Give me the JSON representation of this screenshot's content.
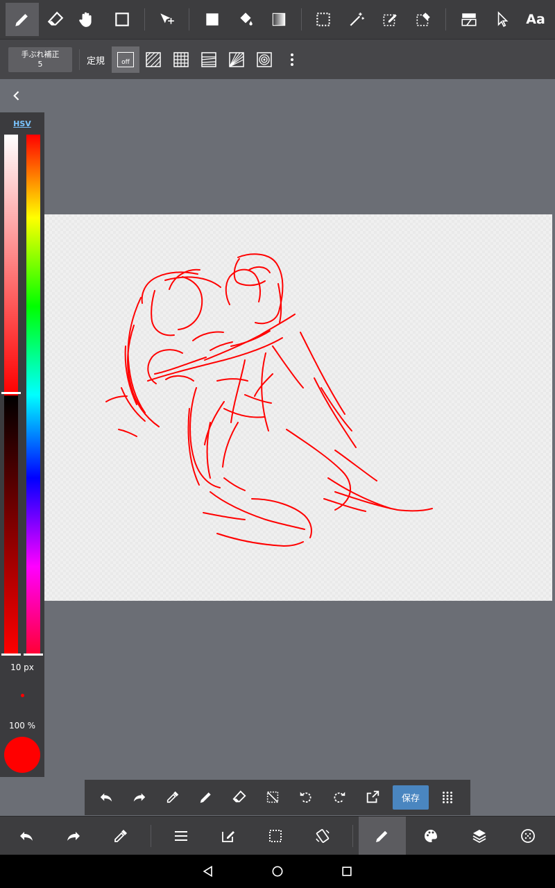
{
  "top_toolbar": {
    "tools": [
      "pen-icon",
      "eraser-icon",
      "hand-icon",
      "rectangle-icon",
      "move-icon",
      "fill-rect-icon",
      "bucket-icon",
      "gradient-icon",
      "select-rect-icon",
      "magic-wand-icon",
      "select-pen-icon",
      "select-eraser-icon",
      "layer-icon",
      "pointer-icon"
    ],
    "text_tool_label": "Aa"
  },
  "sub_toolbar": {
    "stabilizer_label": "手ぶれ補正",
    "stabilizer_value": "5",
    "ruler_label": "定規",
    "ruler_off_label": "off"
  },
  "color_panel": {
    "mode_label": "HSV",
    "brush_size": "10 px",
    "opacity": "100 %",
    "current_color": "#ff0000"
  },
  "quick_bar": {
    "save_label": "保存"
  },
  "colors": {
    "stroke": "#ff0000",
    "accent": "#4a86c0",
    "toolbar_bg": "#3d3d3f"
  }
}
